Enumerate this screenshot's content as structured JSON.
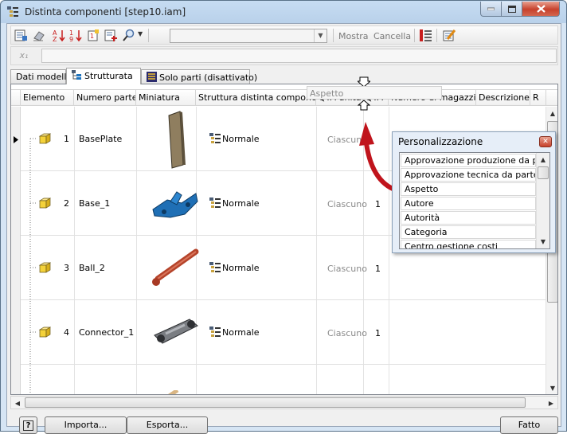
{
  "window": {
    "title": "Distinta componenti [step10.iam]"
  },
  "toolbar": {
    "view_combo_value": "",
    "show_label": "Mostra",
    "clear_label": "Cancella"
  },
  "formula_bar": {
    "fx_label": "x₁",
    "value": ""
  },
  "tabs": [
    {
      "label": "Dati modello"
    },
    {
      "label": "Strutturata"
    },
    {
      "label": "Solo parti (disattivato)"
    }
  ],
  "columns": [
    "Elemento",
    "Numero parte",
    "Miniatura",
    "Struttura distinta componenti",
    "QTÀ unità",
    "QTÀ",
    "Numero di magazzino",
    "Descrizione",
    "R"
  ],
  "rows": [
    {
      "item": "1",
      "part": "BasePlate",
      "structure": "Normale",
      "unit_qty": "Ciascuno",
      "qty": ""
    },
    {
      "item": "2",
      "part": "Base_1",
      "structure": "Normale",
      "unit_qty": "Ciascuno",
      "qty": "1"
    },
    {
      "item": "3",
      "part": "Ball_2",
      "structure": "Normale",
      "unit_qty": "Ciascuno",
      "qty": "1"
    },
    {
      "item": "4",
      "part": "Connector_1",
      "structure": "Normale",
      "unit_qty": "Ciascuno",
      "qty": "1"
    }
  ],
  "drag_tooltip": "Aspetto",
  "customization": {
    "title": "Personalizzazione",
    "items": [
      "Approvazione produzione da p...",
      "Approvazione tecnica da parte di",
      "Aspetto",
      "Autore",
      "Autorità",
      "Categoria",
      "Centro gestione costi"
    ]
  },
  "buttons": {
    "help": "?",
    "import": "Importa...",
    "export": "Esporta...",
    "done": "Fatto"
  },
  "colors": {
    "arrow_red": "#c0141c",
    "part_yellow": "#f4d23a",
    "accent_blue": "#1f6fb5"
  }
}
